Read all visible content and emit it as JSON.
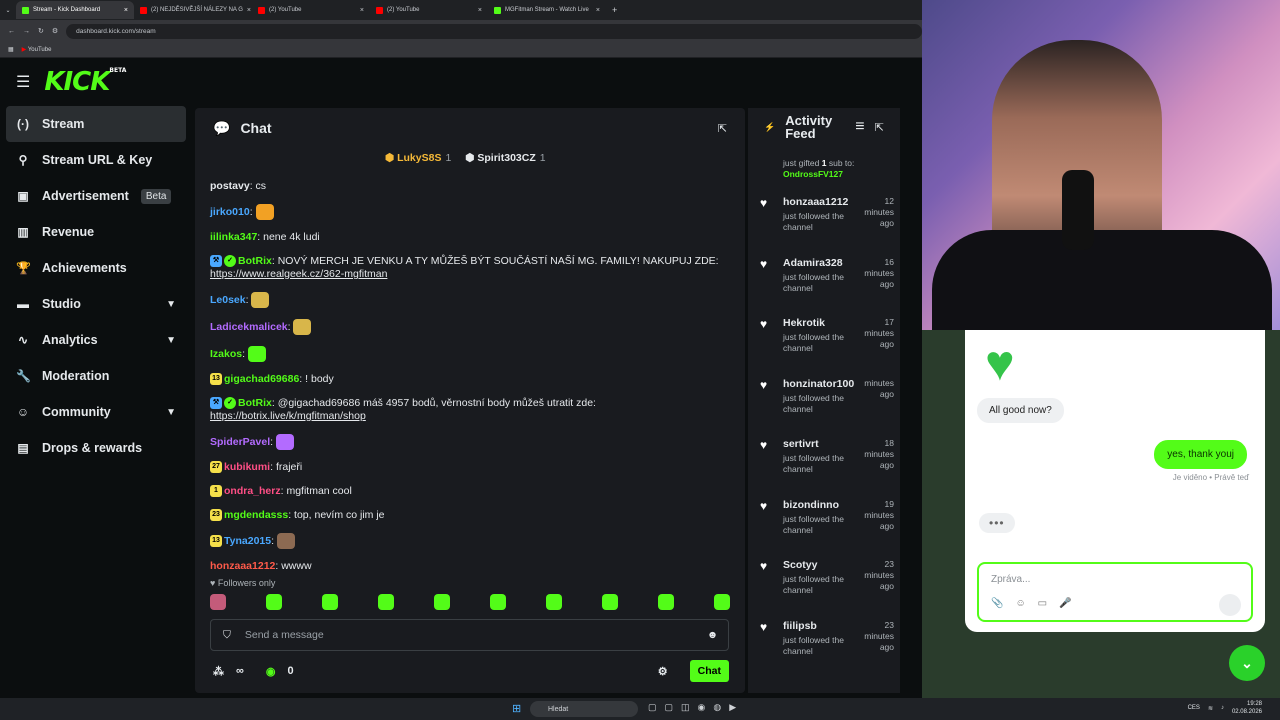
{
  "browser": {
    "tabs": [
      {
        "title": "Stream - Kick Dashboard",
        "active": true,
        "color": "#53fc18"
      },
      {
        "title": "(2) NEJDĚSIVĚJŠÍ NÁLEZY NA G",
        "active": false,
        "color": "#ff0000"
      },
      {
        "title": "(2) YouTube",
        "active": false,
        "color": "#ff0000"
      },
      {
        "title": "(2) YouTube",
        "active": false,
        "color": "#ff0000"
      },
      {
        "title": "MGFitman Stream - Watch Live",
        "active": false,
        "color": "#53fc18"
      }
    ],
    "url": "dashboard.kick.com/stream",
    "bookmark": "YouTube"
  },
  "brand": {
    "logo": "KICK",
    "beta": "BETA",
    "accent": "#53fc18"
  },
  "sidebar": {
    "items": [
      {
        "label": "Stream",
        "icon": "broadcast-icon",
        "glyph": "(·)",
        "active": true
      },
      {
        "label": "Stream URL & Key",
        "icon": "link-icon",
        "glyph": "⚲"
      },
      {
        "label": "Advertisement",
        "icon": "ad-icon",
        "glyph": "▣",
        "badge": "Beta"
      },
      {
        "label": "Revenue",
        "icon": "chart-icon",
        "glyph": "▥"
      },
      {
        "label": "Achievements",
        "icon": "trophy-icon",
        "glyph": "🏆"
      },
      {
        "label": "Studio",
        "icon": "studio-icon",
        "glyph": "▬",
        "chevron": true
      },
      {
        "label": "Analytics",
        "icon": "analytics-icon",
        "glyph": "∿",
        "chevron": true
      },
      {
        "label": "Moderation",
        "icon": "wrench-icon",
        "glyph": "🔧"
      },
      {
        "label": "Community",
        "icon": "community-icon",
        "glyph": "☺",
        "chevron": true
      },
      {
        "label": "Drops & rewards",
        "icon": "drops-icon",
        "glyph": "▤"
      }
    ]
  },
  "chat": {
    "title": "Chat",
    "gifters": [
      {
        "name": "LukyS8S",
        "count": "1",
        "color": "#f5b938"
      },
      {
        "name": "Spirit303CZ",
        "count": "1",
        "color": "#e6e9ec"
      }
    ],
    "messages": [
      {
        "user": "postavy",
        "color": "#e6e9ec",
        "text": "cs"
      },
      {
        "user": "jirko010",
        "color": "#4aa8ff",
        "text": "",
        "emote": "#f2a124"
      },
      {
        "user": "iilinka347",
        "color": "#53fc18",
        "text": "nene 4k ludi"
      },
      {
        "user": "BotRix",
        "color": "#53fc18",
        "text": "NOVÝ MERCH JE VENKU A TY MŮŽEŠ BÝT SOUČÁSTÍ NAŠÍ MG. FAMILY! NAKUPUJ ZDE: ",
        "link": "https://www.realgeek.cz/362-mgfitman",
        "badges": true
      },
      {
        "user": "Le0sek",
        "color": "#4aa8ff",
        "text": "",
        "emote": "#d8b64a"
      },
      {
        "user": "Ladicekmalicek",
        "color": "#b36bff",
        "text": "",
        "emote": "#d8b64a"
      },
      {
        "user": "Izakos",
        "color": "#53fc18",
        "text": "",
        "emote": "#53fc18"
      },
      {
        "user": "gigachad69686",
        "color": "#53fc18",
        "text": "! body",
        "badge": "13"
      },
      {
        "user": "BotRix",
        "color": "#53fc18",
        "text": "@gigachad69686 máš 4957 bodů, věrnostní body můžeš utratit zde: ",
        "link": "https://botrix.live/k/mgfitman/shop",
        "badges": true
      },
      {
        "user": "SpiderPavel",
        "color": "#b36bff",
        "text": "",
        "emote": "#b36bff"
      },
      {
        "user": "kubikumi",
        "color": "#ff4f86",
        "text": "frajeři",
        "badge": "27"
      },
      {
        "user": "ondra_herz",
        "color": "#ff4f86",
        "text": "mgfitman cool",
        "badge": "1"
      },
      {
        "user": "mgdendasss",
        "color": "#53fc18",
        "text": "top, nevím co jim je",
        "badge": "23"
      },
      {
        "user": "Tyna2015",
        "color": "#4aa8ff",
        "text": "",
        "badge": "13",
        "emote": "#8c6a52"
      },
      {
        "user": "honzaaa1212",
        "color": "#ff5a4a",
        "text": "wwww"
      }
    ],
    "followers_only": "Followers only",
    "input_placeholder": "Send a message",
    "viewers": "∞",
    "points": "0",
    "chat_button": "Chat"
  },
  "activity": {
    "title": "Activity Feed",
    "top": {
      "text1": "just gifted ",
      "count": "1",
      "text2": " sub to:",
      "target": "OndrossFV127"
    },
    "items": [
      {
        "name": "honzaaa1212",
        "time": "12 minutes ago",
        "sub": "just followed the channel"
      },
      {
        "name": "Adamira328",
        "time": "16 minutes ago",
        "sub": "just followed the channel"
      },
      {
        "name": "Hekrotik",
        "time": "17 minutes ago",
        "sub": "just followed the channel"
      },
      {
        "name": "honzinator100",
        "time": "minutes ago",
        "sub": "just followed the channel"
      },
      {
        "name": "sertivrt",
        "time": "18 minutes ago",
        "sub": "just followed the channel"
      },
      {
        "name": "bizondinno",
        "time": "19 minutes ago",
        "sub": "just followed the channel"
      },
      {
        "name": "Scotyy",
        "time": "23 minutes ago",
        "sub": "just followed the channel"
      },
      {
        "name": "fiilipsb",
        "time": "23 minutes ago",
        "sub": "just followed the channel"
      }
    ]
  },
  "widget": {
    "incoming": "All good now?",
    "outgoing": "yes, thank youj",
    "seen": "Je viděno • Právě teď",
    "typing": "•••",
    "placeholder": "Zpráva..."
  },
  "taskbar": {
    "search": "Hledat",
    "lang": "CES",
    "time": "19:28",
    "date": "02.08.2026"
  }
}
